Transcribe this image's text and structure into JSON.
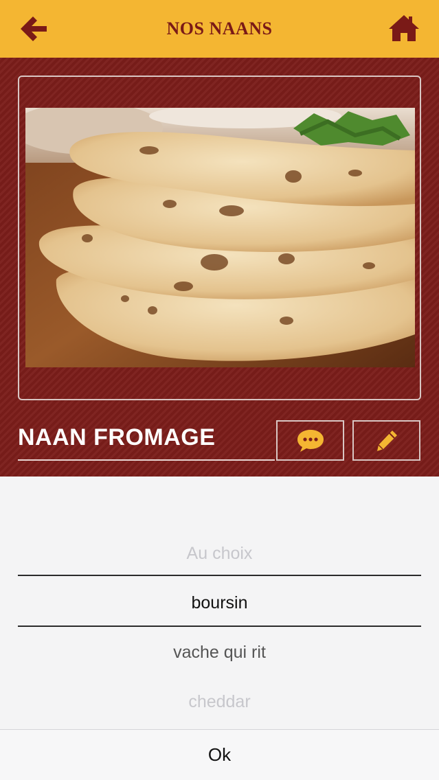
{
  "header": {
    "title": "NOS NAANS",
    "back_icon": "arrow-left-icon",
    "home_icon": "home-icon",
    "accent_color": "#f4b632",
    "icon_color": "#7a1a17"
  },
  "item": {
    "name": "NAAN FROMAGE",
    "photo_subject": "stack of naan breads",
    "comment_icon": "speech-bubble-icon",
    "edit_icon": "pencil-icon",
    "background_color": "#7b1d1a"
  },
  "picker": {
    "options": [
      "Au choix",
      "boursin",
      "vache qui rit",
      "cheddar"
    ],
    "selected": "boursin",
    "confirm_label": "Ok"
  }
}
